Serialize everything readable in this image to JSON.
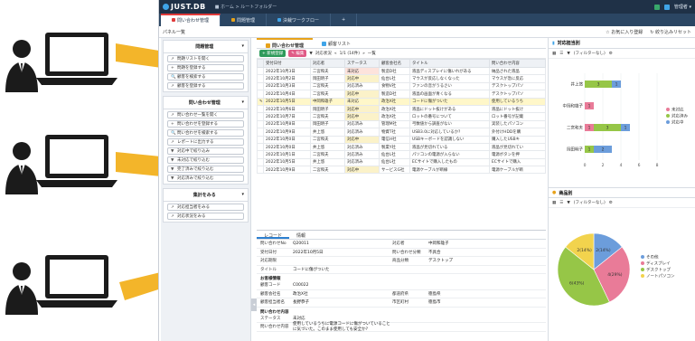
{
  "app": {
    "logo": "JUST.DB",
    "breadcrumb": "■ ホーム > ルートフォルダー",
    "user": "管理者 ▾",
    "tabs": [
      {
        "label": "問い合わせ管理",
        "color": "#e03b3b"
      },
      {
        "label": "問題管理",
        "color": "#e7a21a"
      },
      {
        "label": "決裁ワークフロー",
        "color": "#3fa4e8"
      },
      {
        "label": "+",
        "color": ""
      }
    ],
    "toolbar_left": "パネル一覧",
    "toolbar_right": [
      "☆ お気に入り登録",
      "↻ 絞り込みリセット"
    ]
  },
  "sidebar": {
    "sections": [
      {
        "title": "問題管理",
        "items": [
          {
            "icon": "↗",
            "label": "問題リストを開く"
          },
          {
            "icon": "+",
            "label": "問題を登録する"
          },
          {
            "icon": "🔍",
            "label": "顧客を検索する"
          },
          {
            "icon": "↗",
            "label": "顧客を登録する"
          }
        ]
      },
      {
        "title": "問い合わせ管理",
        "items": [
          {
            "icon": "↗",
            "label": "問い合わせ一覧を開く"
          },
          {
            "icon": "+",
            "label": "問い合わせを登録する"
          },
          {
            "icon": "🔍",
            "label": "問い合わせを検索する"
          },
          {
            "icon": "↗",
            "label": "レポートに出力する"
          },
          {
            "icon": "▼",
            "label": "対応中で絞り込み"
          },
          {
            "icon": "▼",
            "label": "未対応で絞り込む"
          },
          {
            "icon": "▼",
            "label": "完了済みで絞り込む"
          },
          {
            "icon": "▼",
            "label": "対応済みで絞り込む"
          }
        ]
      },
      {
        "title": "集計をみる",
        "items": [
          {
            "icon": "↗",
            "label": "対応担当者をみる"
          },
          {
            "icon": "↗",
            "label": "対応状況をみる"
          }
        ]
      }
    ]
  },
  "main": {
    "tabs": [
      "問い合わせ管理",
      "顧客リスト"
    ],
    "grid_toolbar": {
      "new": "+ 新規登録",
      "edit": "✎ 編集",
      "filter": "対応状況",
      "page": "1/1 (14件)",
      "view": "一覧"
    },
    "columns": [
      "",
      "受付日付",
      "対応者",
      "ステータス",
      "顧客会社名",
      "タイトル",
      "問い合わせ内容"
    ],
    "rows": [
      [
        "",
        "2022年10月3日",
        "二宮和夫",
        "未対応",
        "製造D社",
        "液晶ディスプレイに傷いれがある",
        "納品された液晶"
      ],
      [
        "",
        "2022年10月2日",
        "岡田明子",
        "対応中",
        "仙台L社",
        "マウスが反応しなくなった",
        "マウスが急に反応"
      ],
      [
        "",
        "2022年10月3日",
        "二宮和夫",
        "対応済み",
        "食物V社",
        "ファンの音がうるさい",
        "デスクトップパソ"
      ],
      [
        "",
        "2022年10月4日",
        "二宮和夫",
        "対応中",
        "製造D社",
        "液晶の画面が青くなる",
        "デスクトップパソ"
      ],
      [
        "✎",
        "2022年10月5日",
        "中岡和雄子",
        "未対応",
        "政治X社",
        "コードに傷がついた",
        "使用しているうち"
      ],
      [
        "",
        "2022年10月6日",
        "岡田明子",
        "対応中",
        "政治X社",
        "液晶にドット抜けがある",
        "液晶にドット抜け"
      ],
      [
        "",
        "2022年10月7日",
        "二宮和夫",
        "対応中",
        "政治X社",
        "ロットの番号について",
        "ロット番号が記載"
      ],
      [
        "",
        "2022年10月8日",
        "岡田明子",
        "対応済み",
        "管理M社",
        "弓数値から調査がない",
        "実装したパソコン"
      ],
      [
        "",
        "2022年10月9日",
        "井上悠",
        "対応済み",
        "物資T社",
        "USB3.0に対応しているか?",
        "外付けHDDを購"
      ],
      [
        "",
        "2022年10月0日",
        "二宮和夫",
        "対応中",
        "電信H社",
        "USBキーボードを認識しない",
        "購入したUSBキ"
      ],
      [
        "",
        "2022年10月0日",
        "井上悠",
        "対応済み",
        "製業Y社",
        "液晶が見切れている",
        "液晶が見切れてい"
      ],
      [
        "",
        "2022年10月1日",
        "二宮和夫",
        "対応済み",
        "仙台L社",
        "パソコンの電源が入らない",
        "電源ボタンを押"
      ],
      [
        "",
        "2022年10月5日",
        "井上悠",
        "対応済み",
        "仙台L社",
        "ECサイトで購入したもの",
        "ECサイトで購入"
      ],
      [
        "",
        "2022年10月9日",
        "二宮和夫",
        "対応中",
        "サービスG社",
        "電源ケーブルが断線",
        "電源ケーブルが断"
      ]
    ]
  },
  "detail": {
    "tabs": [
      "レコード",
      "情報"
    ],
    "fields": [
      [
        "問い合わせNo",
        "Q20011",
        "対応者",
        "中岡和雄子"
      ],
      [
        "受付日付",
        "2022年10月5日",
        "問い合わせ分類",
        "不具合"
      ],
      [
        "対応期限",
        "",
        "商品分類",
        "デスクトップ"
      ],
      [
        "タイトル",
        "コードに傷がついた",
        "",
        ""
      ]
    ],
    "section_customer": "お客様情報",
    "customer_fields": [
      [
        "顧客コード",
        "C00022",
        "",
        ""
      ],
      [
        "顧客会社名",
        "政治X社",
        "都道府県",
        "徳島県"
      ],
      [
        "顧客担当者名",
        "長野恭子",
        "市区町村",
        "徳島市"
      ]
    ],
    "section_inquiry": "問い合わせ内容",
    "inquiry_fields": [
      [
        "ステータス",
        "未対応"
      ],
      [
        "問い合わせ内容",
        "使用しているうちに電源コードに傷がついていることに気づいた。このまま使用しても安全か?"
      ]
    ]
  },
  "right": {
    "panel1_title": "対応担当別",
    "panel1_filter": "(フィルターなし)",
    "panel2_title": "商品別",
    "panel2_filter": "(フィルターなし)"
  },
  "chart_data": [
    {
      "type": "bar",
      "orientation": "horizontal",
      "stacked": true,
      "title": "対応担当別",
      "categories": [
        "井上悠",
        "中岡和雄子",
        "二宮和夫",
        "岡田明子"
      ],
      "series": [
        {
          "name": "未対応",
          "color": "#e97b98",
          "values": [
            0,
            1,
            1,
            0
          ]
        },
        {
          "name": "対応済み",
          "color": "#96c647",
          "values": [
            3,
            0,
            3,
            1
          ]
        },
        {
          "name": "対応中",
          "color": "#6c9ddb",
          "values": [
            1,
            0,
            1,
            2
          ]
        }
      ],
      "xlim": [
        0,
        8
      ],
      "xticks": [
        0,
        2,
        4,
        6,
        8
      ],
      "legend": "right"
    },
    {
      "type": "pie",
      "title": "商品別",
      "labels": [
        "その他",
        "ディスプレイ",
        "デスクトップ",
        "ノートパソコン"
      ],
      "values": [
        2,
        4,
        6,
        2
      ],
      "slice_labels": [
        "2(14%)",
        "4(29%)",
        "6(43%)",
        "2(14%)"
      ],
      "colors": [
        "#6c9ddb",
        "#e97b98",
        "#96c647",
        "#f2d34d"
      ],
      "legend": "right"
    }
  ]
}
